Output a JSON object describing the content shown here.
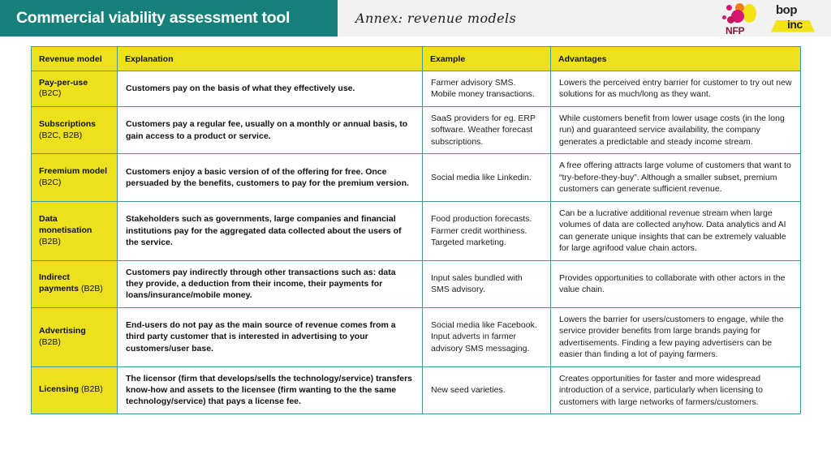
{
  "header": {
    "title": "Commercial viability assessment tool",
    "subtitle": "Annex: revenue models",
    "band_color": "#17807a",
    "logos": [
      {
        "name": "NFP",
        "text": "NFP"
      },
      {
        "name": "BoP Inc",
        "line1": "bop",
        "line2": "inc"
      }
    ]
  },
  "table": {
    "columns": [
      "Revenue model",
      "Explanation",
      "Example",
      "Advantages"
    ],
    "header_bg": "#ede11e",
    "border_color": "#3f9a93",
    "rows": [
      {
        "model_name": "Pay-per-use",
        "model_segment": "(B2C)",
        "model_inline": false,
        "explanation": "Customers pay on the basis of what they effectively use.",
        "example": "Farmer advisory SMS. Mobile money transactions.",
        "advantages": "Lowers the perceived entry barrier for customer to try out new solutions for as much/long as they want."
      },
      {
        "model_name": "Subscriptions",
        "model_segment": "(B2C, B2B)",
        "model_inline": false,
        "explanation": "Customers pay a regular fee, usually on a monthly or annual basis, to gain access to a product or service.",
        "example": "SaaS providers for eg. ERP software. Weather forecast subscriptions.",
        "advantages": "While customers benefit from lower usage costs (in the long run) and guaranteed service availability, the company generates a predictable and steady income stream."
      },
      {
        "model_name": "Freemium model",
        "model_segment": "(B2C)",
        "model_inline": true,
        "explanation": "Customers enjoy a basic version of of the offering for free. Once persuaded by the benefits, customers to pay for the premium version.",
        "example": "Social media like Linkedin.",
        "advantages": "A free offering attracts large volume of customers that want to “try-before-they-buy”.  Although a smaller subset, premium customers can generate sufficient revenue."
      },
      {
        "model_name": "Data monetisation",
        "model_segment": "(B2B)",
        "model_inline": false,
        "explanation": "Stakeholders such as governments, large companies and financial institutions pay for the aggregated data collected about the users of the service.",
        "example": "Food production forecasts. Farmer credit worthiness. Targeted marketing.",
        "advantages": "Can be a lucrative additional revenue stream when large volumes of data are collected anyhow. Data analytics and AI can generate unique insights that can be extremely valuable for large agrifood value chain actors."
      },
      {
        "model_name": "Indirect payments",
        "model_segment": "(B2B)",
        "model_inline": true,
        "explanation": "Customers pay indirectly through other transactions such as: data they provide, a deduction from their income, their payments for loans/insurance/mobile money.",
        "example": "Input sales bundled with SMS advisory.",
        "advantages": "Provides opportunities to collaborate with other actors in the value chain."
      },
      {
        "model_name": "Advertising",
        "model_segment": "(B2B)",
        "model_inline": false,
        "explanation": "End-users do not pay as the main source of revenue comes from a third party customer that is interested in advertising to your customers/user base.",
        "example": "Social media like Facebook. Input adverts in farmer advisory SMS messaging.",
        "advantages": "Lowers the barrier for users/customers to engage, while the service provider benefits from large brands paying for advertisements. Finding a few paying advertisers can be easier than finding a lot of paying farmers."
      },
      {
        "model_name": "Licensing",
        "model_segment": "(B2B)",
        "model_inline": true,
        "explanation": "The licensor (firm that develops/sells the technology/service) transfers know-how and assets to the licensee (firm wanting to the the same technology/service) that pays a license fee.",
        "example": "New seed varieties.",
        "advantages": "Creates opportunities for faster and more widespread introduction of a service, particularly when licensing to customers with large networks of farmers/customers."
      }
    ]
  }
}
